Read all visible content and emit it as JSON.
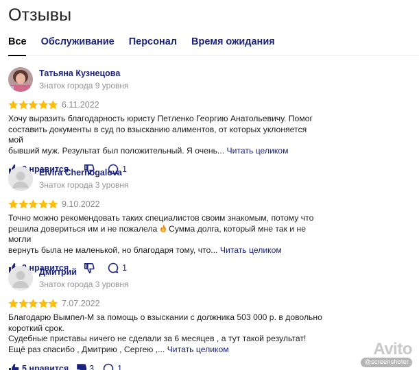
{
  "page": {
    "title": "Отзывы"
  },
  "tabs": [
    {
      "label": "Все",
      "active": true
    },
    {
      "label": "Обслуживание",
      "active": false
    },
    {
      "label": "Персонал",
      "active": false
    },
    {
      "label": "Время ожидания",
      "active": false
    }
  ],
  "colors": {
    "link": "#1a237e",
    "star": "#fcbd0b",
    "muted": "#949494"
  },
  "reviews": [
    {
      "author": "Татьяна Кузнецова",
      "level": "Знаток города 9 уровня",
      "avatar": "photo-avatar",
      "rating": 5,
      "date": "6.11.2022",
      "lines": [
        "Хочу выразить благодарность юристу Петленко Георгию Анатольевичу. Помог",
        "составить документы в суд по взысканию алиментов, от которых уклоняется мой",
        "бывший муж. Результат был положительный. Я очень..."
      ],
      "more": "Читать целиком",
      "likes": "2 нравится",
      "dislikes": "",
      "comments": "1"
    },
    {
      "author": "Elvira Chernogalova",
      "level": "Знаток города 3 уровня",
      "avatar": "default-avatar",
      "rating": 5,
      "date": "9.10.2022",
      "lines": [
        "Точно можно рекомендовать таких специалистов своим знакомым, потому что",
        "решила довериться им и не пожалела",
        "Сумма долга, который мне так и не могли",
        "вернуть была не маленькой, но благодаря тому, что..."
      ],
      "more": "Читать целиком",
      "likes": "3 нравится",
      "dislikes": "",
      "comments": "1"
    },
    {
      "author": "Дмитрий",
      "level": "Знаток города 3 уровня",
      "avatar": "default-avatar",
      "rating": 5,
      "date": "7.07.2022",
      "lines": [
        "Благодарю Вымпел-М за помощь о взыскании с должника 503 000 р. в довольно",
        "короткий срок.",
        "Судебные приставы ничего не сделали за 6 месяцев , а тут такой результат!",
        "Ещё раз спасибо , Дмитрию , Сергею ,..."
      ],
      "more": "Читать целиком",
      "likes": "5 нравится",
      "dislikes": "3",
      "comments": "1"
    }
  ],
  "watermark": {
    "brand": "Avito",
    "sub": "@screenshoter"
  }
}
